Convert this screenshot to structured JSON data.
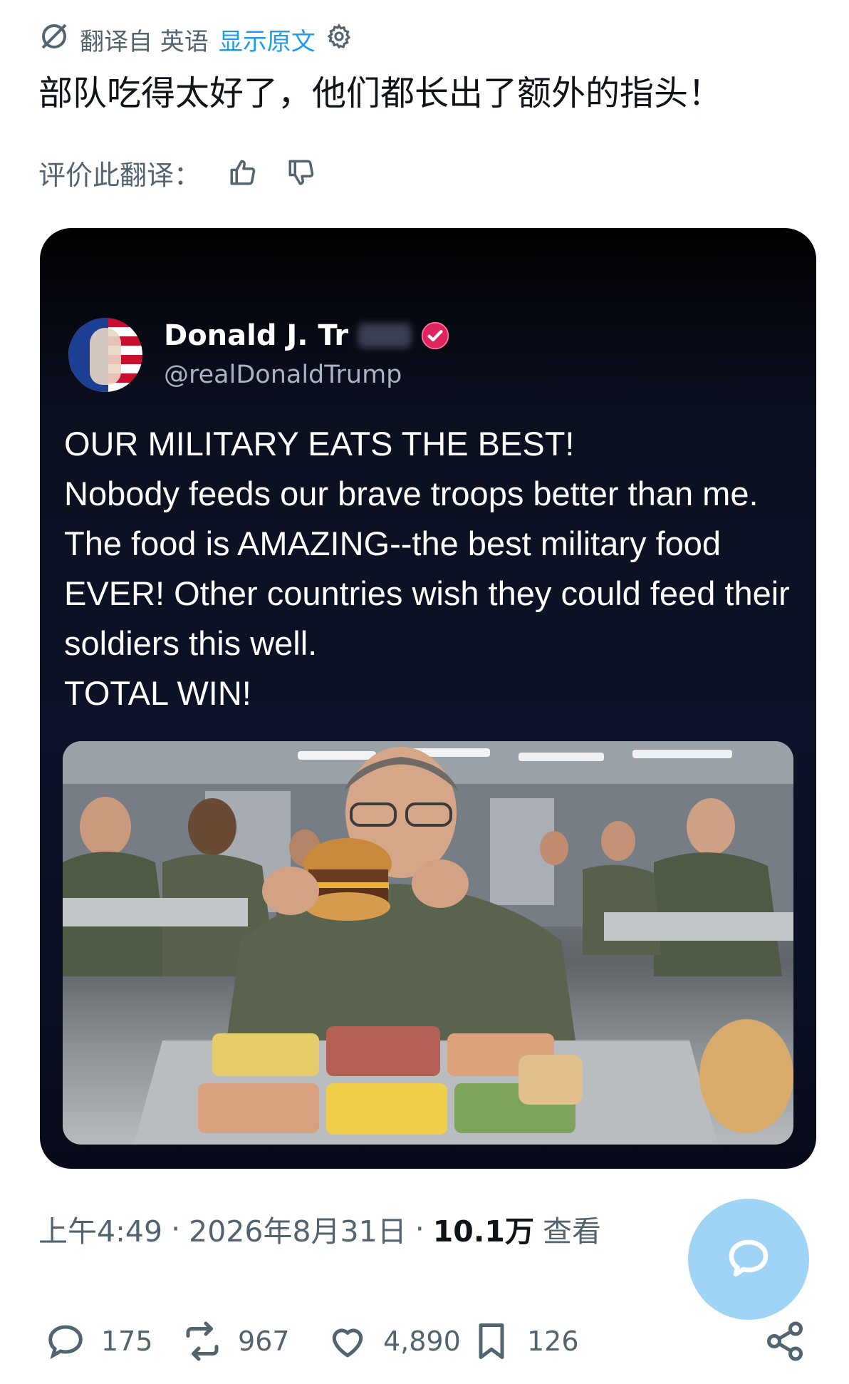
{
  "translation": {
    "translated_from": "翻译自 英语",
    "show_original": "显示原文",
    "text": "部队吃得太好了，他们都长出了额外的指头！",
    "rate_label": "评价此翻译："
  },
  "quoted_post": {
    "author_name": "Donald J. Tr",
    "handle": "@realDonaldTrump",
    "lines": [
      "OUR MILITARY EATS THE BEST!",
      "Nobody feeds our brave troops better than me. The food is AMAZING--the best military food EVER! Other countries wish they could feed their soldiers this well.",
      "TOTAL WIN!"
    ],
    "image_description_icon": "mess-hall-photo"
  },
  "meta": {
    "time": "上午4:49",
    "dot1": "·",
    "date": "2026年8月31日",
    "dot2": "·",
    "views_count": "10.1万",
    "views_label": "查看"
  },
  "actions": {
    "replies": "175",
    "reposts": "967",
    "likes": "4,890",
    "bookmarks": "126"
  },
  "colors": {
    "accent": "#1d9bf0",
    "card_bg": "#0b1020",
    "verified": "#e0245e",
    "fab": "#9fd4f7"
  }
}
